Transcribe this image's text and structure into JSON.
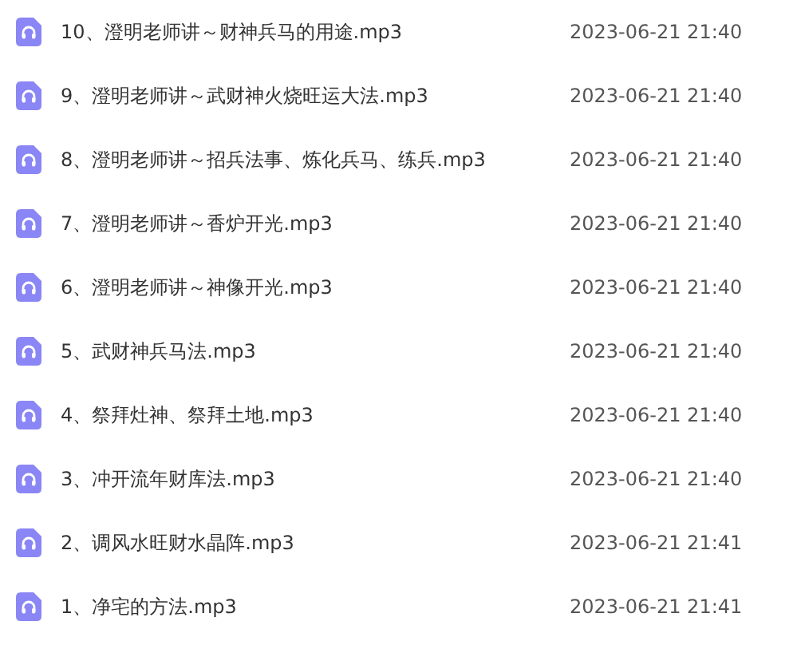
{
  "files": [
    {
      "name": "10、澄明老师讲～财神兵马的用途.mp3",
      "date": "2023-06-21 21:40"
    },
    {
      "name": "9、澄明老师讲～武财神火烧旺运大法.mp3",
      "date": "2023-06-21 21:40"
    },
    {
      "name": "8、澄明老师讲～招兵法事、炼化兵马、练兵.mp3",
      "date": "2023-06-21 21:40"
    },
    {
      "name": "7、澄明老师讲～香炉开光.mp3",
      "date": "2023-06-21 21:40"
    },
    {
      "name": "6、澄明老师讲～神像开光.mp3",
      "date": "2023-06-21 21:40"
    },
    {
      "name": "5、武财神兵马法.mp3",
      "date": "2023-06-21 21:40"
    },
    {
      "name": "4、祭拜灶神、祭拜土地.mp3",
      "date": "2023-06-21 21:40"
    },
    {
      "name": "3、冲开流年财库法.mp3",
      "date": "2023-06-21 21:40"
    },
    {
      "name": "2、调风水旺财水晶阵.mp3",
      "date": "2023-06-21 21:41"
    },
    {
      "name": "1、净宅的方法.mp3",
      "date": "2023-06-21 21:41"
    }
  ]
}
